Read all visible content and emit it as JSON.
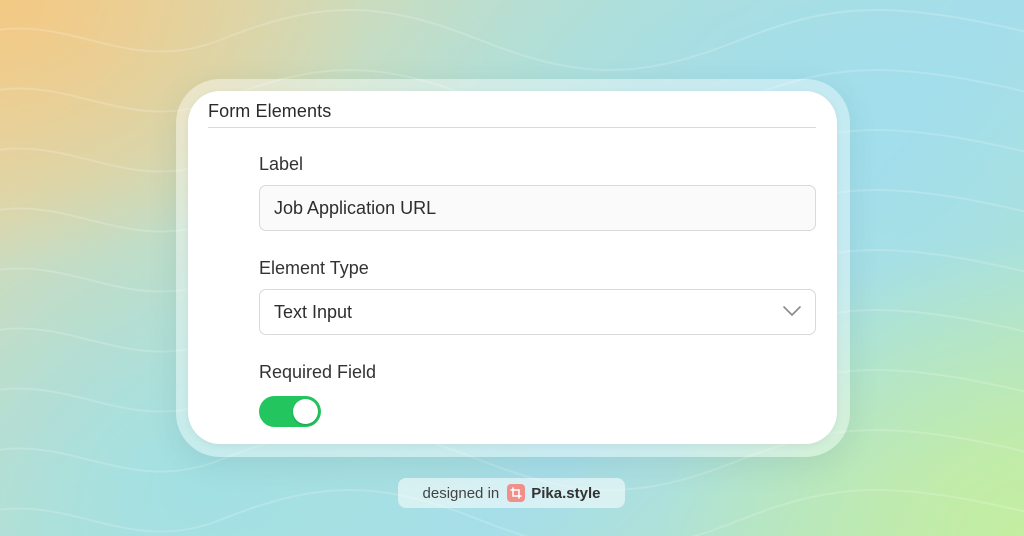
{
  "section": {
    "title": "Form Elements"
  },
  "fields": {
    "label": {
      "label": "Label",
      "value": "Job Application URL"
    },
    "element_type": {
      "label": "Element Type",
      "selected": "Text Input"
    },
    "required": {
      "label": "Required Field",
      "enabled": true
    }
  },
  "badge": {
    "prefix": "designed in",
    "brand": "Pika.style",
    "logo_icon": "pika-crop-icon"
  },
  "colors": {
    "toggle_on": "#22c55e",
    "logo": "#f0908a"
  }
}
